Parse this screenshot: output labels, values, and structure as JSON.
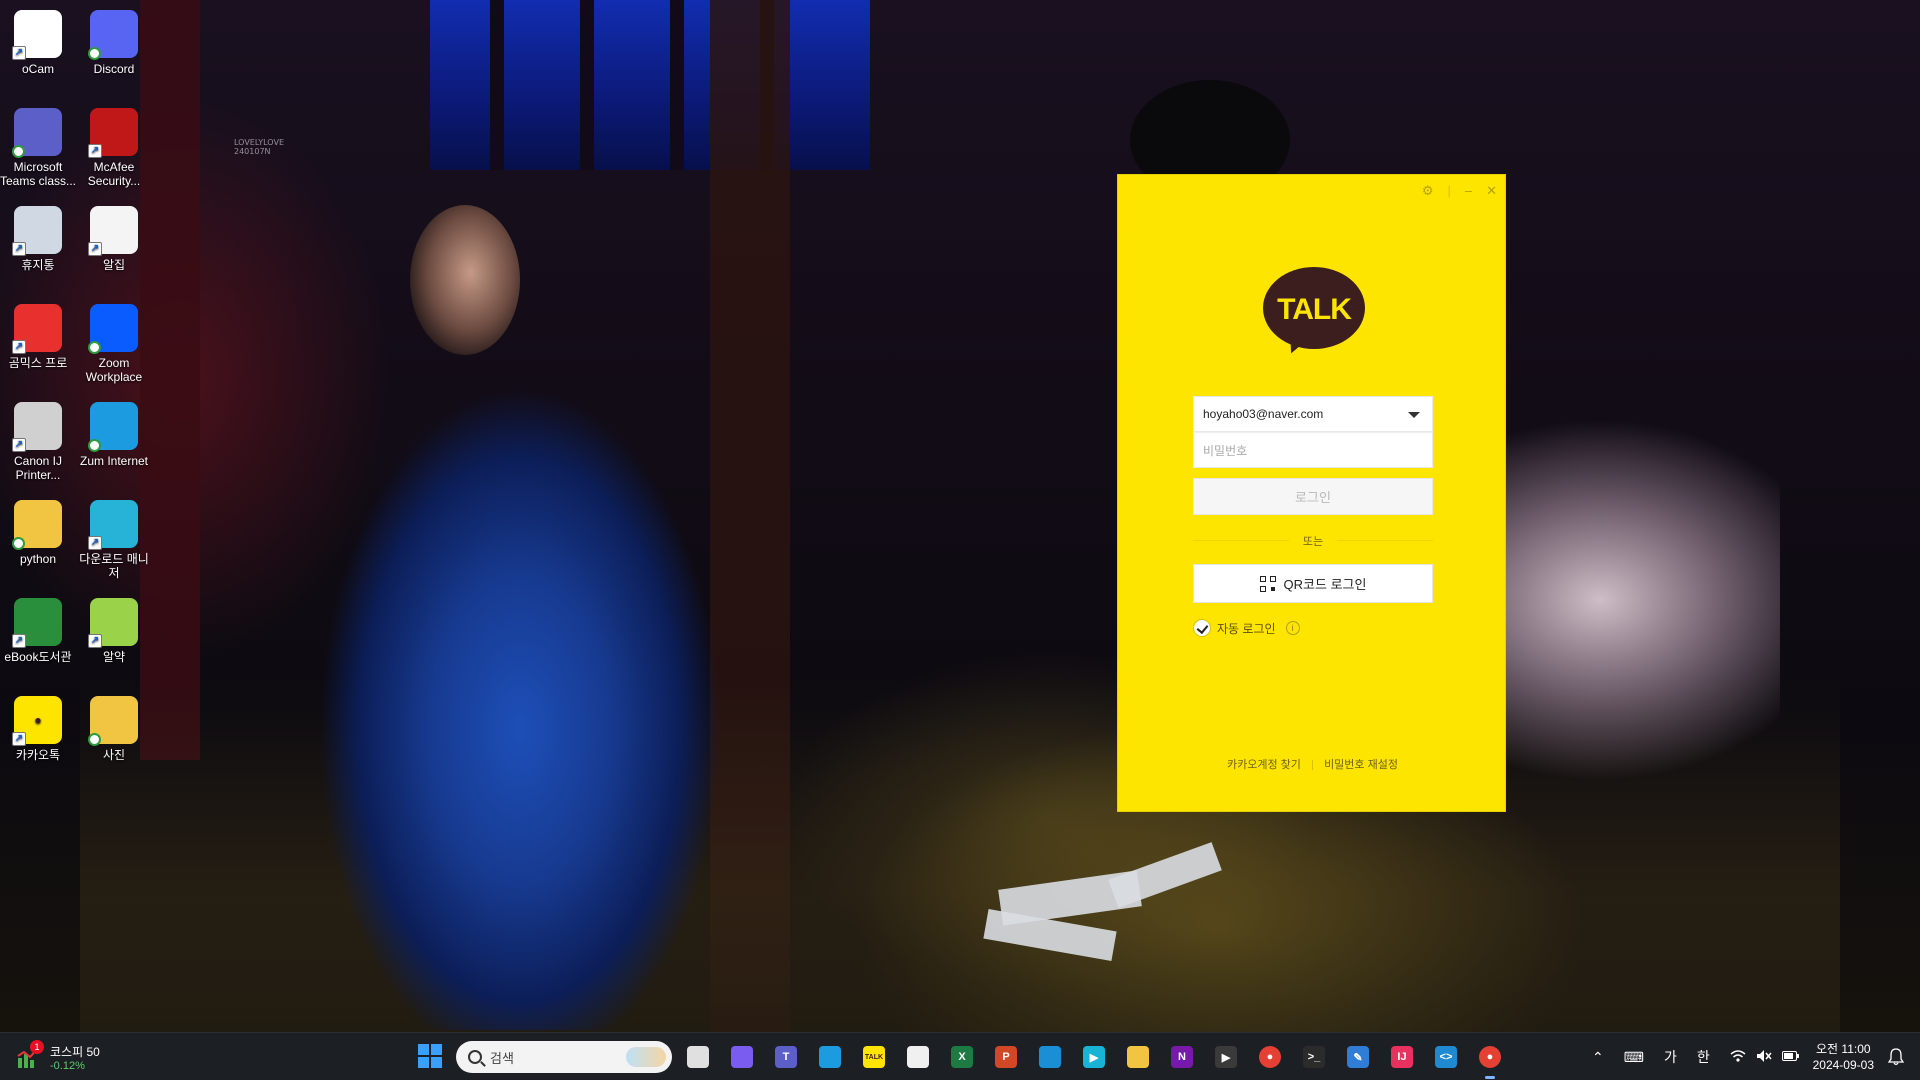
{
  "desktop": {
    "icons": [
      {
        "label": "oCam",
        "icon": "ocam-icon",
        "color": "#ffffff"
      },
      {
        "label": "Discord",
        "icon": "discord-icon",
        "color": "#5865f2"
      },
      {
        "label": "Microsoft Teams class...",
        "icon": "teams-icon",
        "color": "#5b5fc7"
      },
      {
        "label": "McAfee Security...",
        "icon": "mcafee-icon",
        "color": "#c01818"
      },
      {
        "label": "휴지통",
        "icon": "recycle-bin-icon",
        "color": "#cfd8e3"
      },
      {
        "label": "알집",
        "icon": "alzip-icon",
        "color": "#f4f4f4"
      },
      {
        "label": "곰믹스 프로",
        "icon": "gommix-icon",
        "color": "#e8312f"
      },
      {
        "label": "Zoom Workplace",
        "icon": "zoom-icon",
        "color": "#0b5cff"
      },
      {
        "label": "Canon IJ Printer...",
        "icon": "printer-icon",
        "color": "#d0d0d0"
      },
      {
        "label": "Zum Internet",
        "icon": "zum-browser-icon",
        "color": "#1d9be0"
      },
      {
        "label": "python",
        "icon": "folder-icon",
        "color": "#f1c542"
      },
      {
        "label": "다운로드 매니저",
        "icon": "download-manager-icon",
        "color": "#27b3d8"
      },
      {
        "label": "eBook도서관",
        "icon": "ebook-icon",
        "color": "#2a8f3c"
      },
      {
        "label": "알약",
        "icon": "alyac-icon",
        "color": "#9ad34a"
      },
      {
        "label": "카카오톡",
        "icon": "kakaotalk-icon",
        "color": "#fee500"
      },
      {
        "label": "사진",
        "icon": "photos-folder-icon",
        "color": "#f1c542"
      }
    ],
    "watermark": "LOVELYLOVE\n240107N"
  },
  "kakao_login": {
    "logo_text": "TALK",
    "email_value": "hoyaho03@naver.com",
    "password_placeholder": "비밀번호",
    "login_button": "로그인",
    "or_text": "또는",
    "qr_button": "QR코드 로그인",
    "auto_login_label": "자동 로그인",
    "find_account": "카카오계정 찾기",
    "reset_password": "비밀번호 재설정",
    "colors": {
      "background": "#fee500",
      "logo": "#3c1e1e"
    }
  },
  "taskbar": {
    "widget_title": "코스피 50",
    "widget_change": "-0.12%",
    "widget_badge": "1",
    "search_placeholder": "검색",
    "apps": [
      "task-view-icon",
      "copilot-icon",
      "teams-icon",
      "edge-icon",
      "kakaotalk-icon",
      "snipping-tool-icon",
      "excel-icon",
      "powerpoint-icon",
      "store-icon",
      "media-icon",
      "file-explorer-icon",
      "onenote-icon",
      "media-player-icon",
      "chrome-icon",
      "terminal-icon",
      "notepad-icon",
      "jetbrains-icon",
      "vscode-icon",
      "chrome-icon"
    ],
    "tray": {
      "ime_mode": "가",
      "lang": "한"
    },
    "clock": {
      "time": "오전 11:00",
      "date": "2024-09-03"
    }
  }
}
